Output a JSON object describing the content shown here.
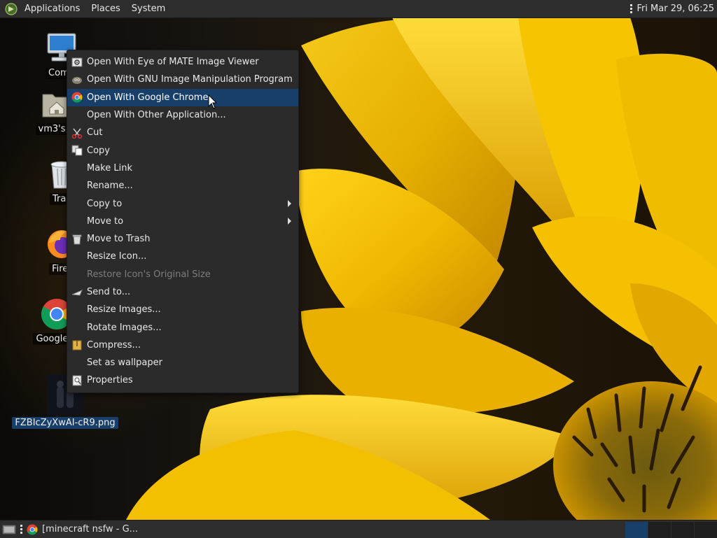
{
  "top_panel": {
    "menus": [
      "Applications",
      "Places",
      "System"
    ],
    "clock": "Fri Mar 29, 06:25"
  },
  "desktop_icons": [
    {
      "label": "Comp",
      "icon": "computer-icon"
    },
    {
      "label": "vm3's H",
      "icon": "home-folder-icon"
    },
    {
      "label": "Tras",
      "icon": "trash-icon"
    },
    {
      "label": "Firef",
      "icon": "firefox-icon"
    },
    {
      "label": "Google C",
      "icon": "chrome-icon"
    },
    {
      "label": "FZBIcZyXwAI-cR9.png",
      "icon": "image-file-icon",
      "selected": true
    }
  ],
  "context_menu": {
    "items": [
      {
        "label": "Open With Eye of MATE Image Viewer",
        "icon": "image-viewer-icon"
      },
      {
        "label": "Open With GNU Image Manipulation Program",
        "icon": "gimp-icon"
      },
      {
        "label": "Open With Google Chrome",
        "icon": "chrome-icon",
        "highlighted": true
      },
      {
        "label": "Open With Other Application..."
      },
      {
        "label": "Cut",
        "icon": "scissors-icon"
      },
      {
        "label": "Copy",
        "icon": "copy-icon"
      },
      {
        "label": "Make Link"
      },
      {
        "label": "Rename..."
      },
      {
        "label": "Copy to",
        "submenu": true
      },
      {
        "label": "Move to",
        "submenu": true
      },
      {
        "label": "Move to Trash",
        "icon": "trash-icon"
      },
      {
        "label": "Resize Icon..."
      },
      {
        "label": "Restore Icon's Original Size",
        "disabled": true
      },
      {
        "label": "Send to...",
        "icon": "send-icon"
      },
      {
        "label": "Resize Images..."
      },
      {
        "label": "Rotate Images..."
      },
      {
        "label": "Compress...",
        "icon": "archive-icon"
      },
      {
        "label": "Set as wallpaper"
      },
      {
        "label": "Properties",
        "icon": "properties-icon"
      }
    ]
  },
  "bottom_panel": {
    "task_title": "[minecraft nsfw - G..."
  },
  "colors": {
    "panel": "#2d2d2d",
    "menu_bg": "#2b2b2b",
    "highlight": "#173f6a",
    "petal": "#f2c200"
  }
}
